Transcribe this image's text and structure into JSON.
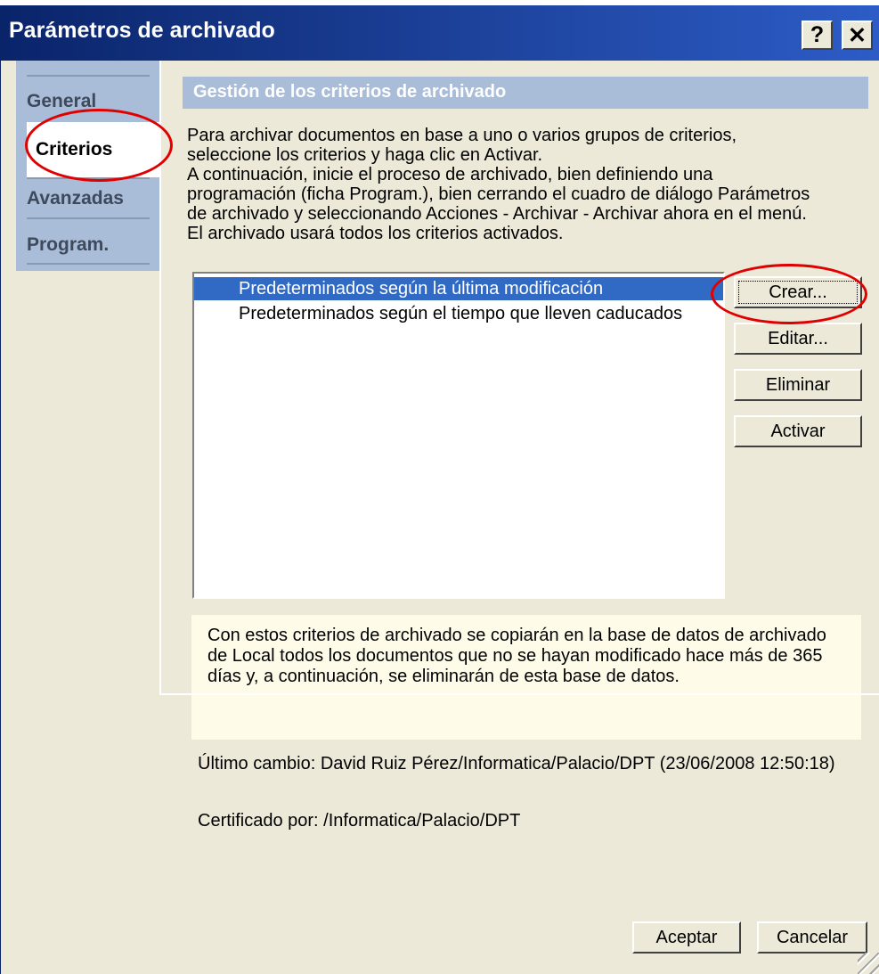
{
  "window": {
    "title": "Parámetros de archivado",
    "help_label": "?",
    "close_label": "✕"
  },
  "tabs": [
    {
      "label": "General"
    },
    {
      "label": "Criterios"
    },
    {
      "label": "Avanzadas"
    },
    {
      "label": "Program."
    }
  ],
  "panel": {
    "title": "Gestión de los criterios de archivado",
    "description_lines": [
      "Para archivar documentos en base a uno o varios grupos de criterios,",
      "seleccione los criterios y haga clic en Activar.",
      "A continuación, inicie el proceso de archivado, bien definiendo una",
      "programación (ficha Program.), bien cerrando el cuadro de diálogo Parámetros",
      "de archivado y seleccionando Acciones - Archivar - Archivar ahora en el menú.",
      "El archivado usará todos los criterios activados."
    ]
  },
  "criteria_list": [
    {
      "label": "Predeterminados según la última modificación",
      "selected": true
    },
    {
      "label": "Predeterminados según el tiempo que lleven caducados",
      "selected": false
    }
  ],
  "buttons": {
    "create": "Crear...",
    "edit": "Editar...",
    "delete": "Eliminar",
    "activate": "Activar",
    "ok": "Aceptar",
    "cancel": "Cancelar"
  },
  "info_text": "Con estos criterios de archivado se copiarán en la base de datos de archivado  de Local todos los documentos que no se hayan modificado hace más de 365 días y, a continuación, se eliminarán de esta base de datos.",
  "last_change": "Último cambio: David Ruiz Pérez/Informatica/Palacio/DPT (23/06/2008 12:50:18)",
  "certified_by": "Certificado por: /Informatica/Palacio/DPT",
  "colors": {
    "title_bar": "#0a246a",
    "selection": "#316ac5",
    "annotation_circle": "#e00000",
    "info_background": "#fefbe9"
  }
}
